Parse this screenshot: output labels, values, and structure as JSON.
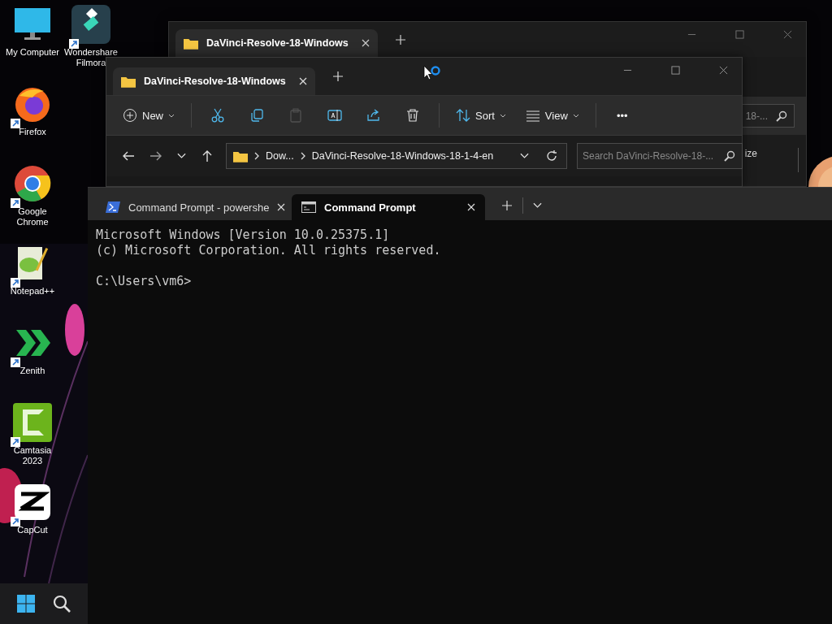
{
  "desktop": {
    "icons": [
      {
        "label": "My Computer",
        "kind": "monitor",
        "shortcut": false
      },
      {
        "label": "Firefox",
        "kind": "firefox",
        "shortcut": true
      },
      {
        "label": "Google Chrome",
        "kind": "chrome",
        "shortcut": true
      },
      {
        "label": "Notepad++",
        "kind": "notepad",
        "shortcut": true
      },
      {
        "label": "Zenith",
        "kind": "zenith",
        "shortcut": true
      },
      {
        "label": "Camtasia 2023",
        "kind": "camtasia",
        "shortcut": true
      },
      {
        "label": "CapCut",
        "kind": "capcut",
        "shortcut": true
      },
      {
        "label": "Wondershare Filmora",
        "kind": "filmora",
        "shortcut": true
      }
    ]
  },
  "back_explorer": {
    "tab": {
      "title": "DaVinci-Resolve-18-Windows"
    },
    "search": {
      "placeholder": "18-..."
    },
    "column_header": "ize"
  },
  "explorer": {
    "tab": {
      "title": "DaVinci-Resolve-18-Windows"
    },
    "toolbar": {
      "groups": [
        {
          "items": [
            {
              "kind": "new",
              "label": "New",
              "disabled": false
            }
          ]
        },
        {
          "items": [
            {
              "kind": "cut",
              "disabled": false
            },
            {
              "kind": "copy",
              "disabled": false
            },
            {
              "kind": "paste",
              "disabled": true
            },
            {
              "kind": "rename",
              "disabled": false
            },
            {
              "kind": "share",
              "disabled": false
            },
            {
              "kind": "delete",
              "disabled": false
            }
          ]
        },
        {
          "items": [
            {
              "kind": "sort",
              "label": "Sort",
              "disabled": false
            },
            {
              "kind": "view",
              "label": "View",
              "disabled": false
            }
          ]
        },
        {
          "items": [
            {
              "kind": "more",
              "label": "•••",
              "disabled": false
            }
          ]
        }
      ]
    },
    "address": {
      "path": [
        "Dow...",
        "DaVinci-Resolve-18-Windows-18-1-4-en"
      ]
    },
    "search": {
      "placeholder": "Search DaVinci-Resolve-18-..."
    }
  },
  "terminal": {
    "tabs": [
      {
        "title": "Command Prompt - powershe",
        "kind": "powershell",
        "selected": false
      },
      {
        "title": "Command Prompt",
        "kind": "cmd",
        "selected": true
      }
    ],
    "output": [
      "Microsoft Windows [Version 10.0.25375.1]",
      "(c) Microsoft Corporation. All rights reserved."
    ],
    "prompt": "C:\\Users\\vm6>"
  }
}
